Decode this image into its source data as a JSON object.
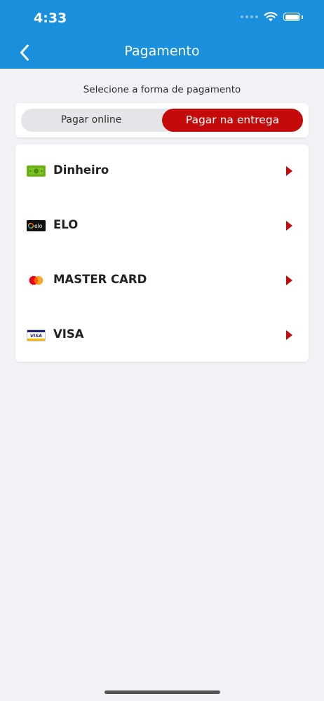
{
  "status_bar": {
    "time": "4:33"
  },
  "header": {
    "title": "Pagamento"
  },
  "subtitle": "Selecione a forma de pagamento",
  "segment": {
    "options": [
      "Pagar online",
      "Pagar na entrega"
    ],
    "selected": "Pagar na entrega"
  },
  "payment_methods": [
    {
      "label": "Dinheiro",
      "icon": "cash-icon"
    },
    {
      "label": "ELO",
      "icon": "elo-card-icon",
      "icon_text": "elo"
    },
    {
      "label": "MASTER CARD",
      "icon": "mastercard-icon"
    },
    {
      "label": "VISA",
      "icon": "visa-card-icon",
      "icon_text": "VISA"
    }
  ],
  "colors": {
    "header": "#1a90dc",
    "accent": "#c40a0a",
    "background": "#f2f2f6"
  }
}
